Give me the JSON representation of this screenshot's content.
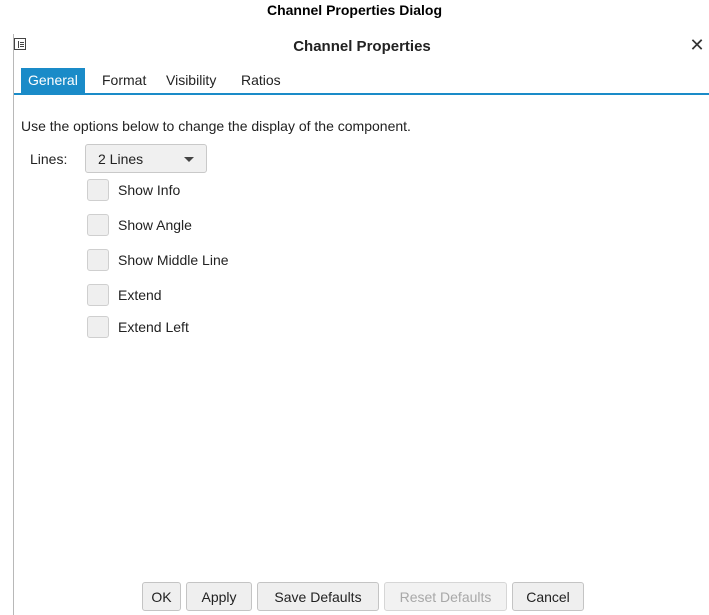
{
  "caption": "Channel Properties Dialog",
  "dialog": {
    "title": "Channel Properties",
    "close_symbol": "✕",
    "tabs": [
      {
        "label": "General",
        "active": true
      },
      {
        "label": "Format",
        "active": false
      },
      {
        "label": "Visibility",
        "active": false
      },
      {
        "label": "Ratios",
        "active": false
      }
    ],
    "description": "Use the options below to change the display of the component.",
    "lines": {
      "label": "Lines:",
      "value": "2 Lines"
    },
    "checkboxes": [
      {
        "label": "Show Info",
        "checked": false
      },
      {
        "label": "Show Angle",
        "checked": false
      },
      {
        "label": "Show Middle Line",
        "checked": false
      },
      {
        "label": "Extend",
        "checked": false
      },
      {
        "label": "Extend Left",
        "checked": false
      }
    ],
    "buttons": [
      {
        "label": "OK",
        "enabled": true
      },
      {
        "label": "Apply",
        "enabled": true
      },
      {
        "label": "Save Defaults",
        "enabled": true
      },
      {
        "label": "Reset Defaults",
        "enabled": false
      },
      {
        "label": "Cancel",
        "enabled": true
      }
    ]
  },
  "colors": {
    "accent": "#1a8bc8",
    "disabled_text": "#a8a8a8"
  },
  "icons": {
    "title_icon": "properties-icon",
    "close_icon": "close-icon",
    "dropdown_icon": "chevron-down-icon"
  }
}
